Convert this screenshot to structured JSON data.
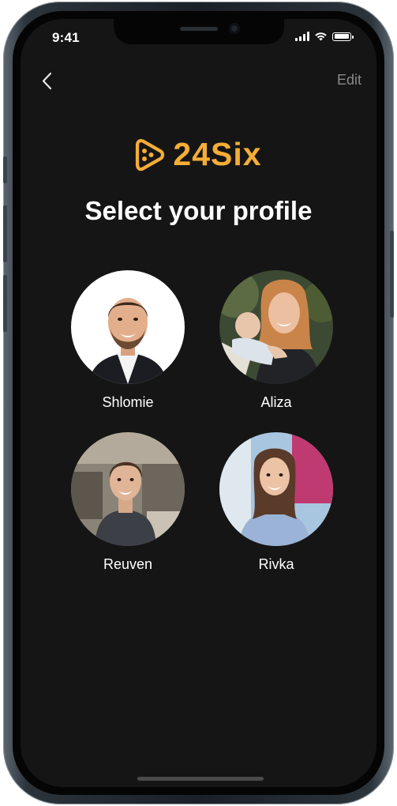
{
  "status_bar": {
    "time": "9:41",
    "battery_level": 1.0
  },
  "nav": {
    "back_icon": "chevron-left-icon",
    "edit_label": "Edit"
  },
  "brand": {
    "name": "24Six",
    "color": "#f4ad36"
  },
  "title": "Select your profile",
  "profiles": [
    {
      "name": "Shlomie"
    },
    {
      "name": "Aliza"
    },
    {
      "name": "Reuven"
    },
    {
      "name": "Rivka"
    }
  ],
  "colors": {
    "background": "#151515",
    "text": "#ffffff",
    "muted": "#8a8a8a"
  }
}
